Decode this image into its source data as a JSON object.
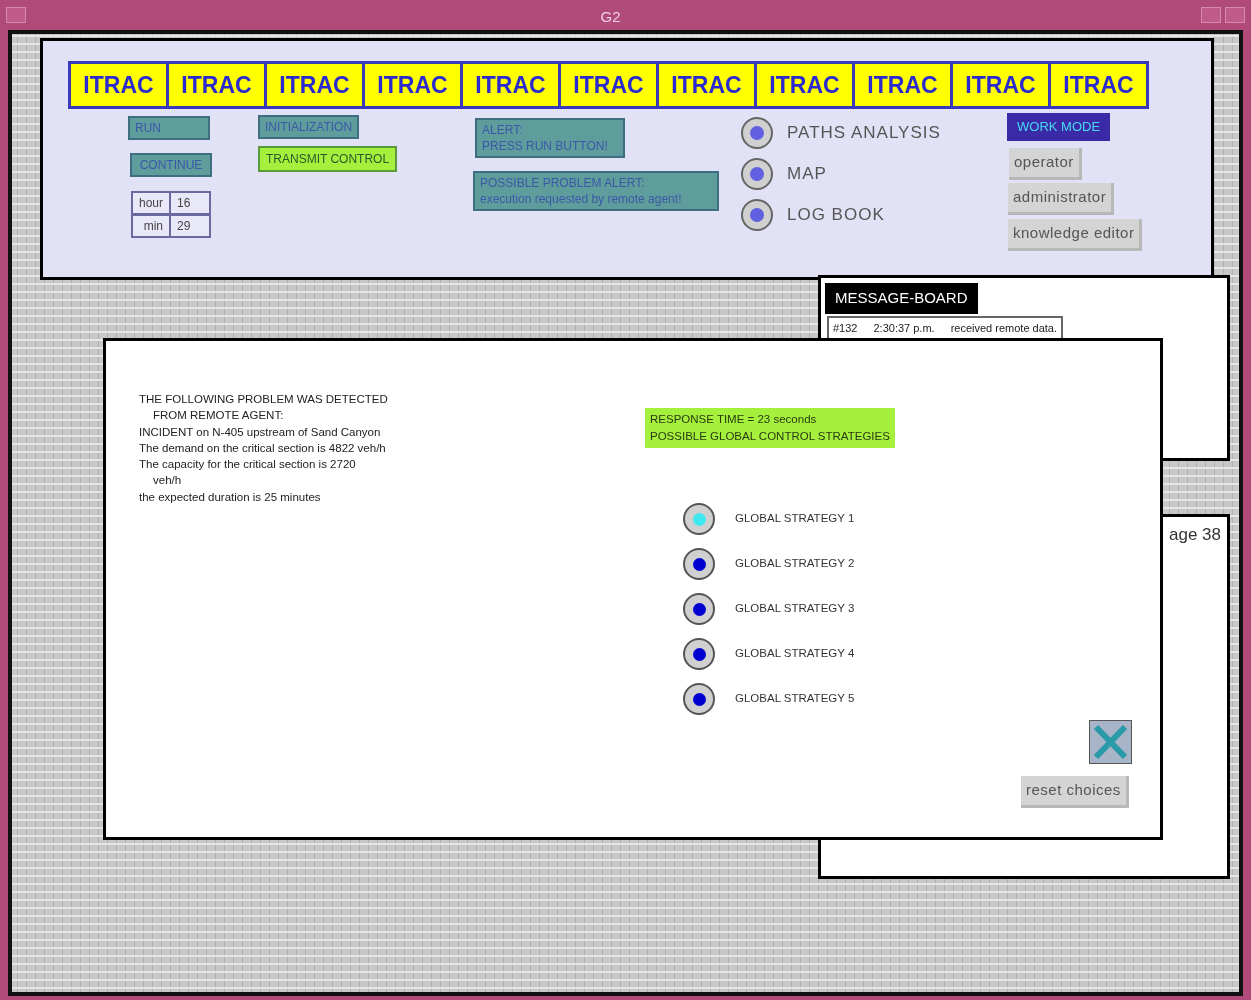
{
  "window": {
    "title": "G2"
  },
  "header_tabs": [
    "ITRAC",
    "ITRAC",
    "ITRAC",
    "ITRAC",
    "ITRAC",
    "ITRAC",
    "ITRAC",
    "ITRAC",
    "ITRAC",
    "ITRAC",
    "ITRAC"
  ],
  "controls": {
    "run": "RUN",
    "continue": "CONTINUE",
    "initialization": "INITIALIZATION",
    "transmit_control": "TRANSMIT CONTROL",
    "clock": [
      {
        "label": "hour",
        "value": "16"
      },
      {
        "label": "min",
        "value": "29"
      }
    ]
  },
  "alerts": [
    {
      "lines": [
        "ALERT:",
        "PRESS RUN BUTTON!"
      ]
    },
    {
      "lines": [
        "POSSIBLE PROBLEM ALERT:",
        "execution requested by remote agent!"
      ]
    }
  ],
  "navigation": [
    {
      "label": "PATHS ANALYSIS",
      "selected": true
    },
    {
      "label": "MAP",
      "selected": true
    },
    {
      "label": "LOG BOOK",
      "selected": true
    }
  ],
  "work_mode": {
    "title": "WORK MODE",
    "options": [
      "operator",
      "administrator",
      "knowledge editor"
    ]
  },
  "message_board": {
    "title": "MESSAGE-BOARD",
    "messages": [
      {
        "number": "#132",
        "time": "2:30:37 p.m.",
        "text": "received remote data."
      }
    ]
  },
  "background_window": {
    "text": "age 38"
  },
  "dialog": {
    "problem_lines": [
      {
        "kind": "line",
        "text": "THE FOLLOWING PROBLEM WAS DETECTED"
      },
      {
        "kind": "continuation",
        "text": "FROM REMOTE AGENT:"
      },
      {
        "kind": "line",
        "text": "INCIDENT on N-405 upstream of Sand Canyon"
      },
      {
        "kind": "line",
        "text": "The demand on the critical section is 4822 veh/h"
      },
      {
        "kind": "line",
        "text": "The capacity for the critical section is 2720"
      },
      {
        "kind": "continuation",
        "text": "veh/h"
      },
      {
        "kind": "line",
        "text": "the expected duration is 25 minutes"
      }
    ],
    "response": [
      "RESPONSE TIME = 23 seconds",
      "POSSIBLE GLOBAL CONTROL STRATEGIES"
    ],
    "strategies": [
      {
        "label": "GLOBAL STRATEGY 1",
        "selected": true
      },
      {
        "label": "GLOBAL STRATEGY 2",
        "selected": false
      },
      {
        "label": "GLOBAL STRATEGY 3",
        "selected": false
      },
      {
        "label": "GLOBAL STRATEGY 4",
        "selected": false
      },
      {
        "label": "GLOBAL STRATEGY 5",
        "selected": false
      }
    ],
    "reset_button": "reset choices"
  }
}
